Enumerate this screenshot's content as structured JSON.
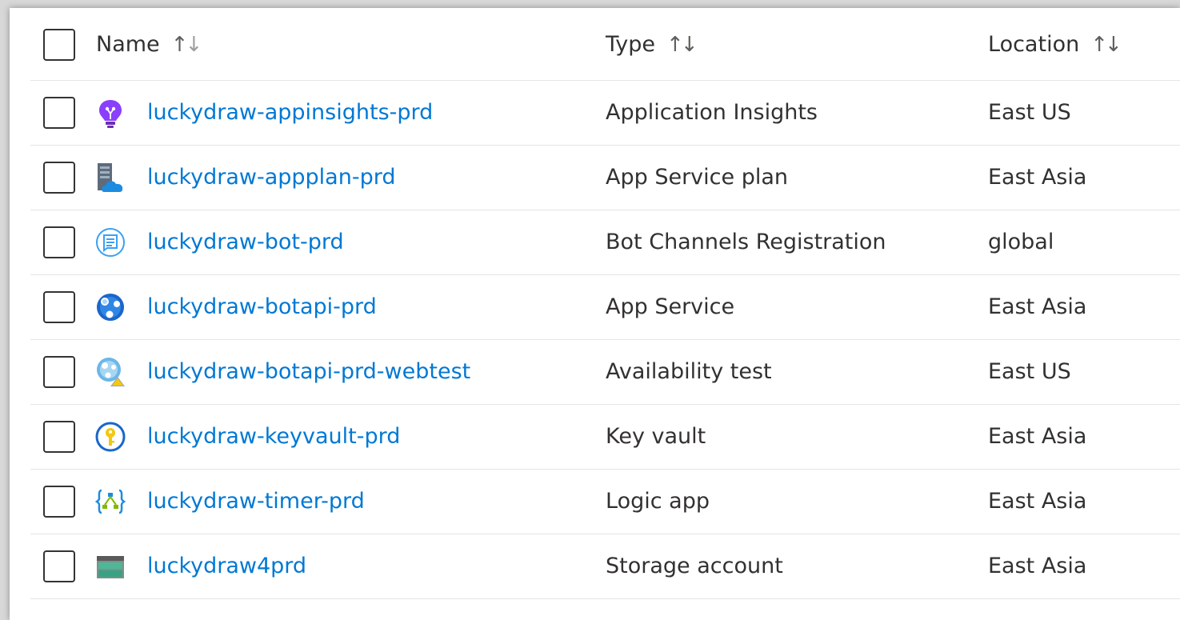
{
  "header": {
    "name_label": "Name",
    "type_label": "Type",
    "location_label": "Location",
    "sort_glyph": "↑↓"
  },
  "rows": [
    {
      "name": "luckydraw-appinsights-prd",
      "type": "Application Insights",
      "location": "East US",
      "icon": "application-insights-icon"
    },
    {
      "name": "luckydraw-appplan-prd",
      "type": "App Service plan",
      "location": "East Asia",
      "icon": "app-service-plan-icon"
    },
    {
      "name": "luckydraw-bot-prd",
      "type": "Bot Channels Registration",
      "location": "global",
      "icon": "bot-channels-icon"
    },
    {
      "name": "luckydraw-botapi-prd",
      "type": "App Service",
      "location": "East Asia",
      "icon": "app-service-icon"
    },
    {
      "name": "luckydraw-botapi-prd-webtest",
      "type": "Availability test",
      "location": "East US",
      "icon": "availability-test-icon"
    },
    {
      "name": "luckydraw-keyvault-prd",
      "type": "Key vault",
      "location": "East Asia",
      "icon": "key-vault-icon"
    },
    {
      "name": "luckydraw-timer-prd",
      "type": "Logic app",
      "location": "East Asia",
      "icon": "logic-app-icon"
    },
    {
      "name": "luckydraw4prd",
      "type": "Storage account",
      "location": "East Asia",
      "icon": "storage-account-icon"
    }
  ],
  "colors": {
    "link": "#0078d4",
    "text": "#323130",
    "divider": "#e5e5e5"
  }
}
